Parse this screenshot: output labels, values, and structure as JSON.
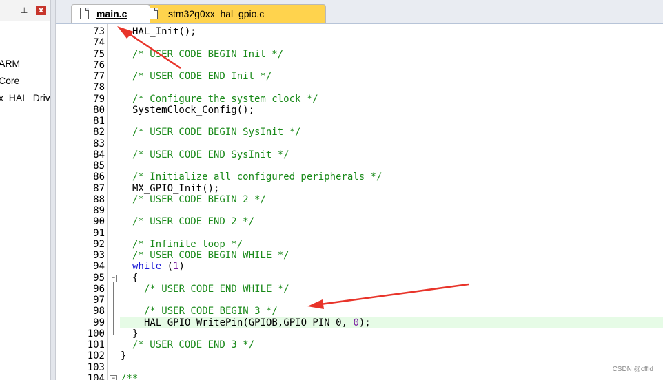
{
  "project_pane": {
    "pin_glyph": "⊥",
    "close_glyph": "x",
    "tree_items": [
      "ARM",
      "Core",
      "x_HAL_Driv"
    ]
  },
  "tabs": [
    {
      "label": "main.c",
      "active": true,
      "color": "#ffffff"
    },
    {
      "label": "stm32g0xx_hal_gpio.c",
      "active": false,
      "color": "#ffd34d"
    }
  ],
  "editor": {
    "highlight_line": "99",
    "lines": [
      {
        "num": "73",
        "code": "HAL_Init();"
      },
      {
        "num": "74",
        "code": ""
      },
      {
        "num": "75",
        "code": "/* USER CODE BEGIN Init */"
      },
      {
        "num": "76",
        "code": ""
      },
      {
        "num": "77",
        "code": "/* USER CODE END Init */"
      },
      {
        "num": "78",
        "code": ""
      },
      {
        "num": "79",
        "code": "/* Configure the system clock */"
      },
      {
        "num": "80",
        "code": "SystemClock_Config();"
      },
      {
        "num": "81",
        "code": ""
      },
      {
        "num": "82",
        "code": "/* USER CODE BEGIN SysInit */"
      },
      {
        "num": "83",
        "code": ""
      },
      {
        "num": "84",
        "code": "/* USER CODE END SysInit */"
      },
      {
        "num": "85",
        "code": ""
      },
      {
        "num": "86",
        "code": "/* Initialize all configured peripherals */"
      },
      {
        "num": "87",
        "code": "MX_GPIO_Init();"
      },
      {
        "num": "88",
        "code": "/* USER CODE BEGIN 2 */"
      },
      {
        "num": "89",
        "code": ""
      },
      {
        "num": "90",
        "code": "/* USER CODE END 2 */"
      },
      {
        "num": "91",
        "code": ""
      },
      {
        "num": "92",
        "code": "/* Infinite loop */"
      },
      {
        "num": "93",
        "code": "/* USER CODE BEGIN WHILE */"
      },
      {
        "num": "94",
        "code_kw": "while",
        "code_rest": " (",
        "code_num": "1",
        "code_end": ")"
      },
      {
        "num": "95",
        "code": "{"
      },
      {
        "num": "96",
        "code": "/* USER CODE END WHILE */"
      },
      {
        "num": "97",
        "code": ""
      },
      {
        "num": "98",
        "code": "/* USER CODE BEGIN 3 */"
      },
      {
        "num": "99",
        "code_pre": "HAL_GPIO_WritePin(GPIOB,GPIO_PIN_0, ",
        "code_num": "0",
        "code_end": ");"
      },
      {
        "num": "100",
        "code": "}"
      },
      {
        "num": "101",
        "code": "/* USER CODE END 3 */"
      },
      {
        "num": "102",
        "code": "}"
      },
      {
        "num": "103",
        "code": ""
      },
      {
        "num": "104",
        "code": "/**"
      }
    ]
  },
  "watermark": "CSDN @cffid",
  "colors": {
    "comment": "#1a8a1a",
    "keyword": "#1a1ad6",
    "number": "#7a1fa0",
    "highlight": "#e6fbe6",
    "arrow": "#e8342a",
    "active_tab_accent": "#ffd34d"
  }
}
